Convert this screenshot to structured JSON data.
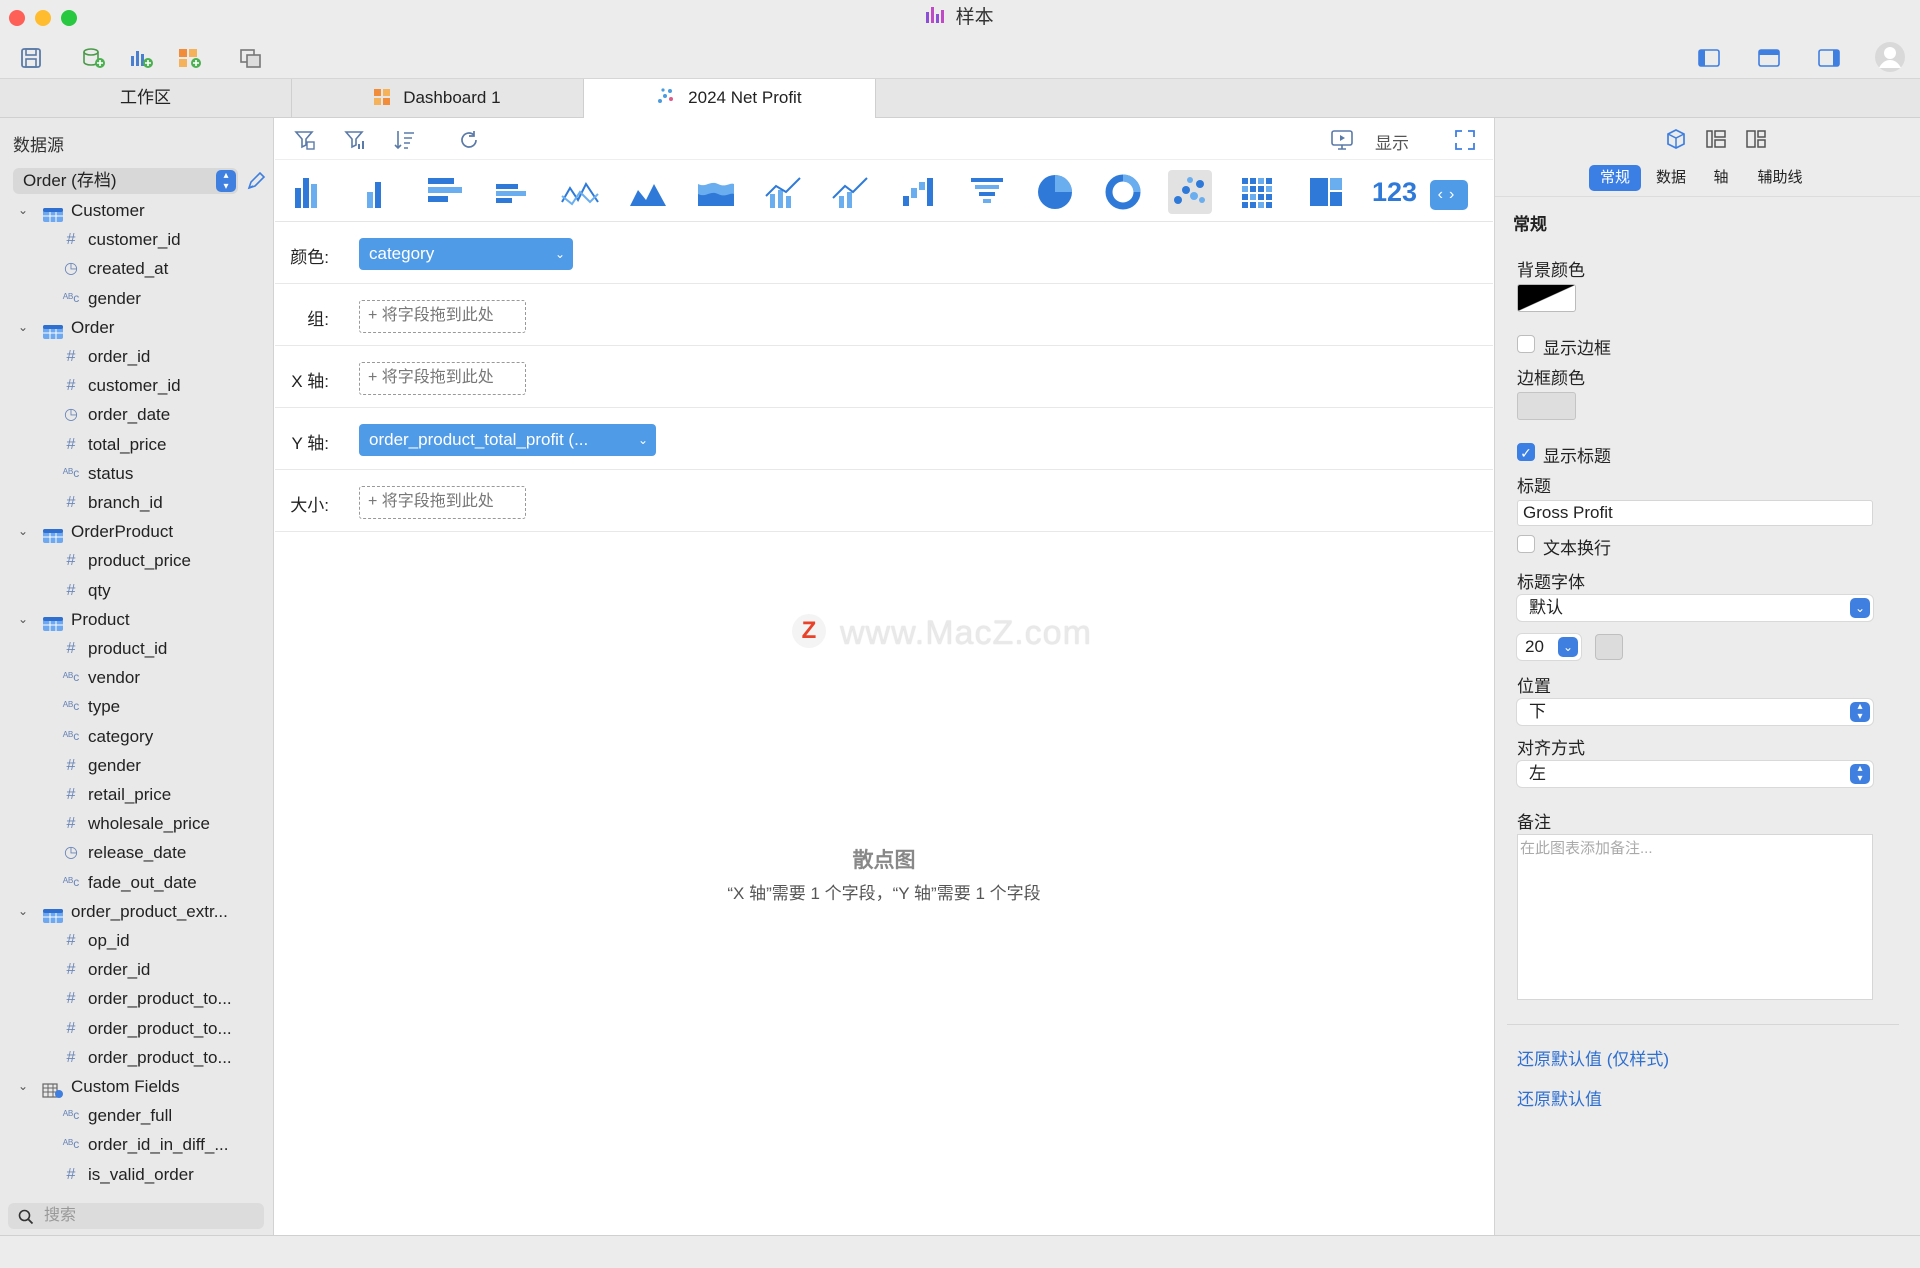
{
  "window": {
    "title": "样本"
  },
  "tabs": [
    {
      "label": "工作区"
    },
    {
      "label": "Dashboard 1"
    },
    {
      "label": "2024 Net Profit"
    }
  ],
  "sidebar": {
    "heading": "数据源",
    "source_select": "Order (存档)",
    "search_placeholder": "搜索",
    "tree": [
      {
        "kind": "table",
        "label": "Customer"
      },
      {
        "kind": "num",
        "label": "customer_id"
      },
      {
        "kind": "time",
        "label": "created_at"
      },
      {
        "kind": "text",
        "label": "gender"
      },
      {
        "kind": "table",
        "label": "Order"
      },
      {
        "kind": "num",
        "label": "order_id"
      },
      {
        "kind": "num",
        "label": "customer_id"
      },
      {
        "kind": "time",
        "label": "order_date"
      },
      {
        "kind": "num",
        "label": "total_price"
      },
      {
        "kind": "text",
        "label": "status"
      },
      {
        "kind": "num",
        "label": "branch_id"
      },
      {
        "kind": "table",
        "label": "OrderProduct"
      },
      {
        "kind": "num",
        "label": "product_price"
      },
      {
        "kind": "num",
        "label": "qty"
      },
      {
        "kind": "table",
        "label": "Product"
      },
      {
        "kind": "num",
        "label": "product_id"
      },
      {
        "kind": "text",
        "label": "vendor"
      },
      {
        "kind": "text",
        "label": "type"
      },
      {
        "kind": "text",
        "label": "category"
      },
      {
        "kind": "num",
        "label": "gender"
      },
      {
        "kind": "num",
        "label": "retail_price"
      },
      {
        "kind": "num",
        "label": "wholesale_price"
      },
      {
        "kind": "time",
        "label": "release_date"
      },
      {
        "kind": "text",
        "label": "fade_out_date"
      },
      {
        "kind": "table",
        "label": "order_product_extr..."
      },
      {
        "kind": "num",
        "label": "op_id"
      },
      {
        "kind": "num",
        "label": "order_id"
      },
      {
        "kind": "num",
        "label": "order_product_to..."
      },
      {
        "kind": "num",
        "label": "order_product_to..."
      },
      {
        "kind": "num",
        "label": "order_product_to..."
      },
      {
        "kind": "custom",
        "label": "Custom Fields"
      },
      {
        "kind": "text",
        "label": "gender_full"
      },
      {
        "kind": "text",
        "label": "order_id_in_diff_..."
      },
      {
        "kind": "num",
        "label": "is_valid_order"
      }
    ]
  },
  "center": {
    "present_label": "显示",
    "number_chart_label": "123",
    "shelves": {
      "color_label": "颜色:",
      "color_value": "category",
      "group_label": "组:",
      "x_label": "X 轴:",
      "y_label": "Y 轴:",
      "y_value": "order_product_total_profit (...",
      "size_label": "大小:",
      "drop_hint": "+ 将字段拖到此处"
    },
    "empty_title": "散点图",
    "empty_hint": "“X 轴”需要 1 个字段，“Y 轴”需要 1 个字段",
    "watermark": "www.MacZ.com",
    "watermark_badge": "Z"
  },
  "inspector": {
    "tabs": [
      "常规",
      "数据",
      "轴",
      "辅助线"
    ],
    "section": "常规",
    "bg_color_label": "背景颜色",
    "show_border_label": "显示边框",
    "show_border": false,
    "border_color_label": "边框颜色",
    "show_title_label": "显示标题",
    "show_title": true,
    "title_label": "标题",
    "title_value": "Gross Profit",
    "wrap_label": "文本换行",
    "wrap": false,
    "title_font_label": "标题字体",
    "title_font_value": "默认",
    "font_size": "20",
    "position_label": "位置",
    "position_value": "下",
    "align_label": "对齐方式",
    "align_value": "左",
    "notes_label": "备注",
    "notes_placeholder": "在此图表添加备注...",
    "reset_style": "还原默认值 (仅样式)",
    "reset_all": "还原默认值"
  },
  "colors": {
    "accent": "#3f7fe0",
    "pill": "#4f9be8",
    "link": "#2f6fd0"
  }
}
